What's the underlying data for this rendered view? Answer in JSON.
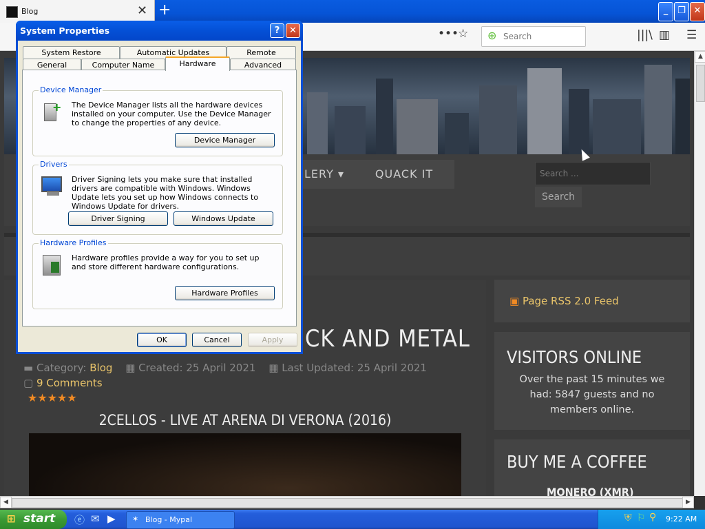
{
  "browser": {
    "tab_title": "Blog",
    "search_placeholder": "Search"
  },
  "site": {
    "nav": [
      "LERY ▾",
      "QUACK IT"
    ],
    "search_placeholder": "Search ...",
    "search_button": "Search",
    "article_title_fragment": "CK AND METAL",
    "category_label": "Category:",
    "category_value": "Blog",
    "created": "Created: 25 April 2021",
    "updated": "Last Updated: 25 April 2021",
    "comments": "9 Comments",
    "rating": "★★★★★",
    "video_title": "2CELLOS - LIVE AT ARENA DI VERONA (2016)",
    "rss": "Page RSS 2.0 Feed",
    "visitors_heading": "VISITORS ONLINE",
    "visitors_text": "Over the past 15 minutes we had: 5847 guests and no members online.",
    "coffee_heading": "BUY ME A COFFEE",
    "coffee_sub": "MONERO (XMR)"
  },
  "dialog": {
    "title": "System Properties",
    "tabs_row1": [
      "System Restore",
      "Automatic Updates",
      "Remote"
    ],
    "tabs_row2": [
      "General",
      "Computer Name",
      "Hardware",
      "Advanced"
    ],
    "groups": {
      "device_manager": {
        "legend": "Device Manager",
        "text": "The Device Manager lists all the hardware devices installed on your computer. Use the Device Manager to change the properties of any device.",
        "button": "Device Manager"
      },
      "drivers": {
        "legend": "Drivers",
        "text": "Driver Signing lets you make sure that installed drivers are compatible with Windows. Windows Update lets you set up how Windows connects to Windows Update for drivers.",
        "button1": "Driver Signing",
        "button2": "Windows Update"
      },
      "hardware_profiles": {
        "legend": "Hardware Profiles",
        "text": "Hardware profiles provide a way for you to set up and store different hardware configurations.",
        "button": "Hardware Profiles"
      }
    },
    "ok": "OK",
    "cancel": "Cancel",
    "apply": "Apply"
  },
  "taskbar": {
    "start": "start",
    "task": "Blog - Mypal",
    "clock": "9:22 AM"
  }
}
